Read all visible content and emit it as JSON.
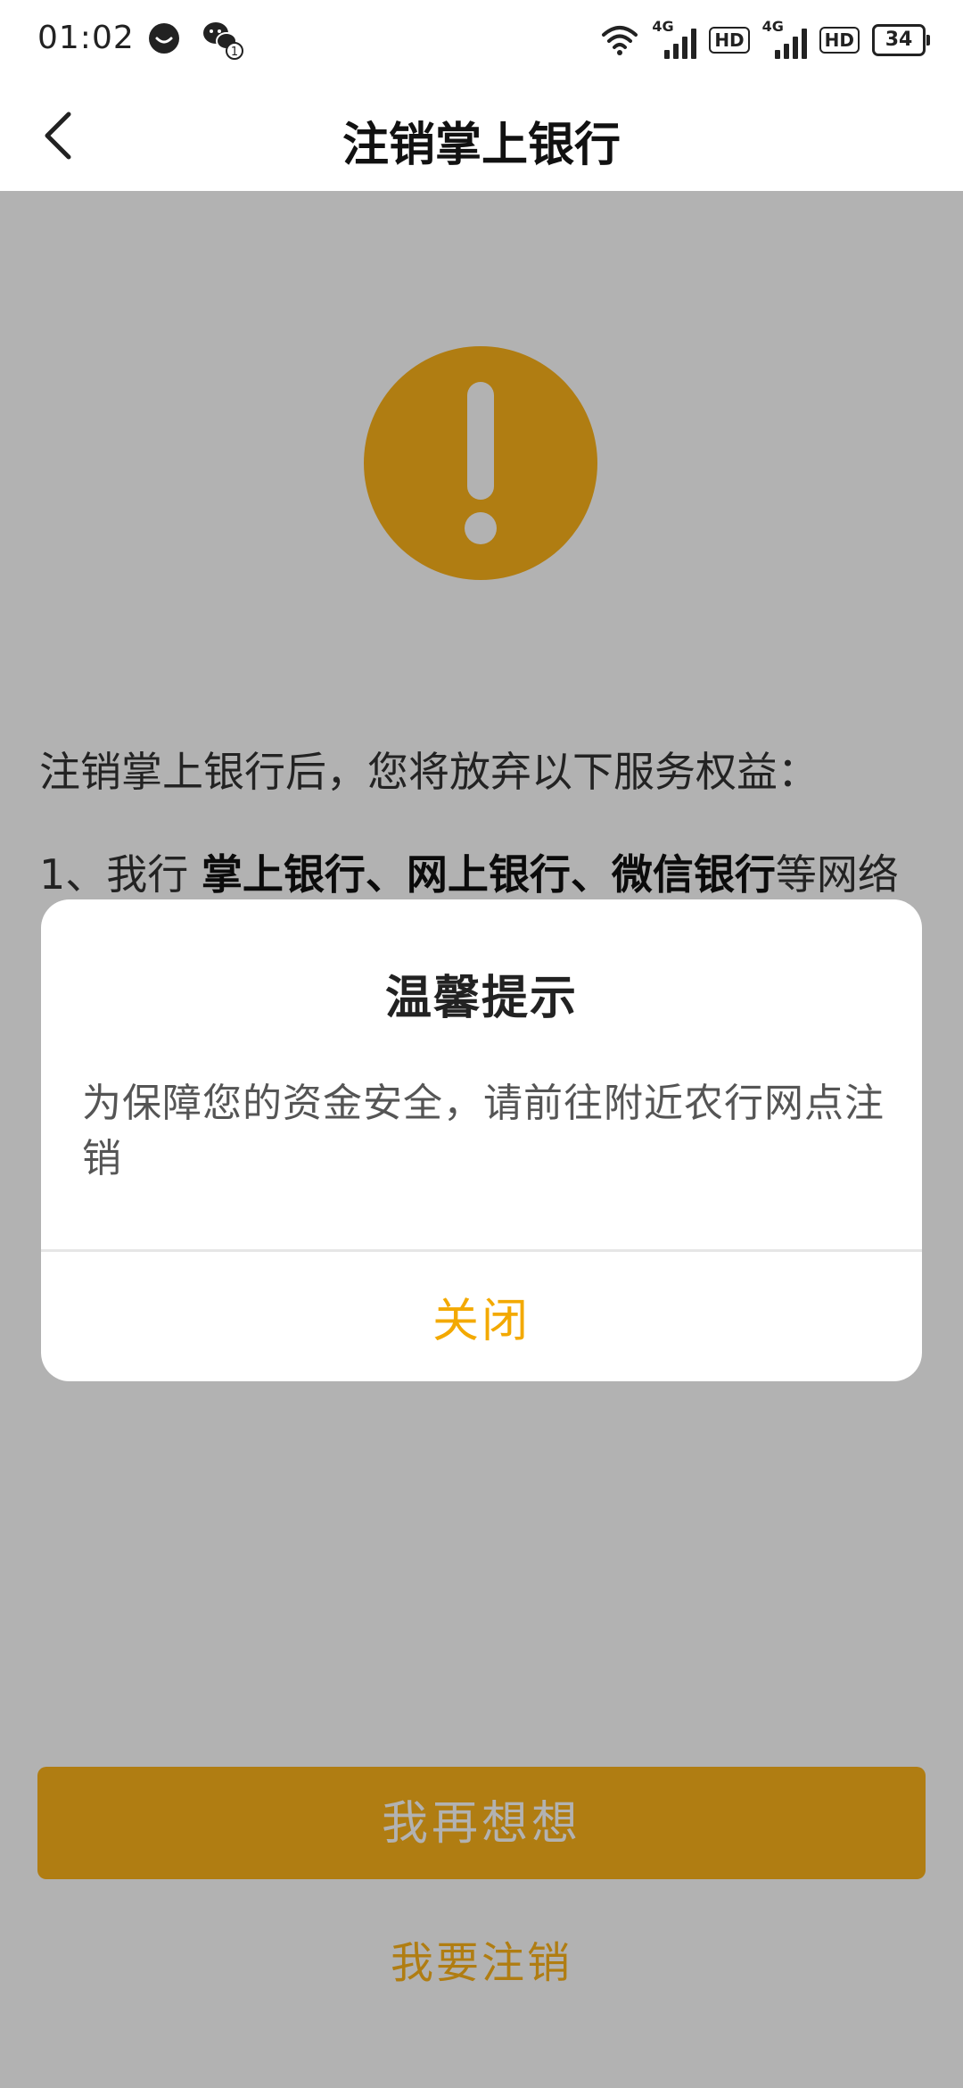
{
  "status_bar": {
    "time": "01:02",
    "network_1": "4G",
    "hd_1": "HD",
    "network_2": "4G",
    "hd_2": "HD",
    "battery": "34",
    "wechat_badge": "1"
  },
  "nav": {
    "title": "注销掌上银行"
  },
  "content": {
    "intro": "注销掌上银行后，您将放弃以下服务权益：",
    "benefit_prefix": "1、我行 ",
    "benefit_bold": "掌上银行、网上银行、微信银行",
    "benefit_suffix": "等网络"
  },
  "actions": {
    "keep_label": "我再想想",
    "cancel_label": "我要注销"
  },
  "dialog": {
    "title": "温馨提示",
    "message": "为保障您的资金安全，请前往附近农行网点注销",
    "close_label": "关闭"
  },
  "colors": {
    "accent": "#fdb31b",
    "close_text": "#f3a900"
  }
}
